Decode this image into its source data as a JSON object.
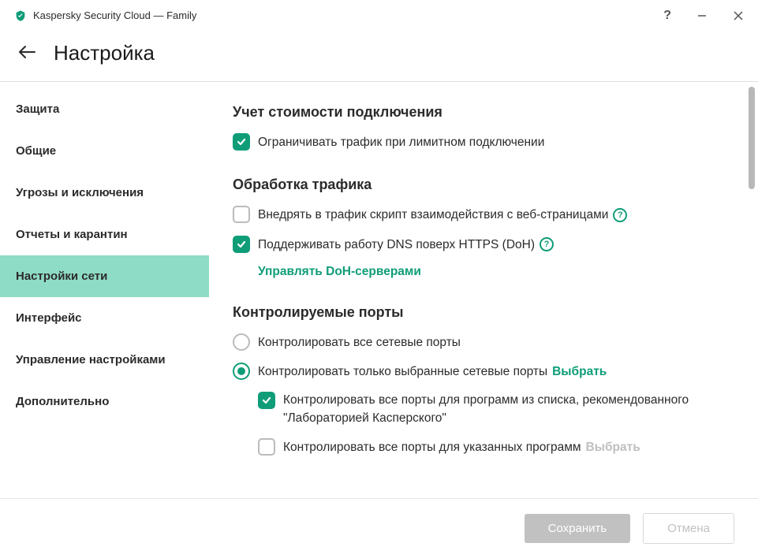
{
  "titlebar": {
    "app_name": "Kaspersky Security Cloud — Family"
  },
  "header": {
    "page_title": "Настройка"
  },
  "sidebar": {
    "items": [
      {
        "label": "Защита"
      },
      {
        "label": "Общие"
      },
      {
        "label": "Угрозы и исключения"
      },
      {
        "label": "Отчеты и карантин"
      },
      {
        "label": "Настройки сети"
      },
      {
        "label": "Интерфейс"
      },
      {
        "label": "Управление настройками"
      },
      {
        "label": "Дополнительно"
      }
    ],
    "active_index": 4
  },
  "content": {
    "section_cost": {
      "title": "Учет стоимости подключения",
      "limit_traffic": {
        "label": "Ограничивать трафик при лимитном подключении",
        "checked": true
      }
    },
    "section_traffic": {
      "title": "Обработка трафика",
      "inject_script": {
        "label": "Внедрять в трафик скрипт взаимодействия с веб-страницами",
        "checked": false
      },
      "doh": {
        "label": "Поддерживать работу DNS поверх HTTPS (DoH)",
        "checked": true
      },
      "manage_doh_link": "Управлять DoH-серверами"
    },
    "section_ports": {
      "title": "Контролируемые порты",
      "radio_all": {
        "label": "Контролировать все сетевые порты",
        "selected": false
      },
      "radio_selected": {
        "label": "Контролировать только выбранные сетевые порты",
        "selected": true
      },
      "select_link": "Выбрать",
      "sub_recommended": {
        "label": "Контролировать все порты для программ из списка, рекомендованного \"Лабораторией Касперского\"",
        "checked": true
      },
      "sub_specified": {
        "label": "Контролировать все порты для указанных программ",
        "checked": false
      },
      "sub_select_link": "Выбрать"
    }
  },
  "footer": {
    "save": "Сохранить",
    "cancel": "Отмена"
  },
  "colors": {
    "accent": "#0f9d78",
    "sidebar_active": "#8fdcc6"
  }
}
